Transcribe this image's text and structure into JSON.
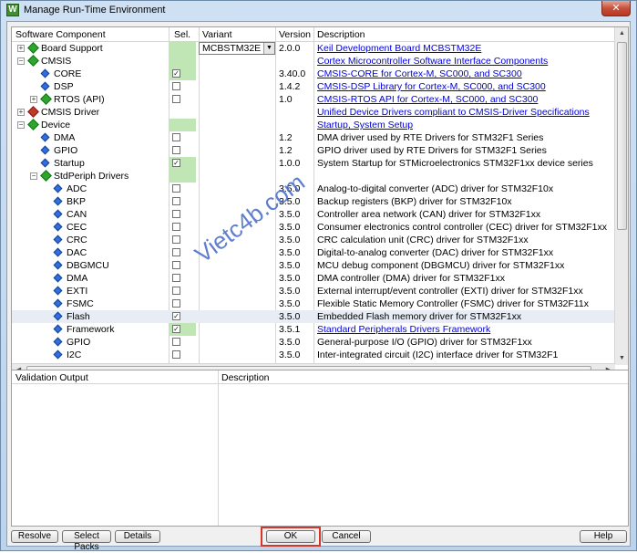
{
  "window": {
    "title": "Manage Run-Time Environment",
    "close_label": "✕"
  },
  "columns": {
    "component": "Software Component",
    "sel": "Sel.",
    "variant": "Variant",
    "version": "Version",
    "description": "Description"
  },
  "rows": [
    {
      "name": "Board Support",
      "variant": "MCBSTM32E",
      "version": "2.0.0",
      "desc": "Keil Development Board MCBSTM32E",
      "link": true
    },
    {
      "name": "CMSIS",
      "version": "",
      "desc": "Cortex Microcontroller Software Interface Components",
      "link": true
    },
    {
      "name": "CORE",
      "version": "3.40.0",
      "desc": "CMSIS-CORE for Cortex-M, SC000, and SC300",
      "link": true,
      "checked": true
    },
    {
      "name": "DSP",
      "version": "1.4.2",
      "desc": "CMSIS-DSP Library for Cortex-M, SC000, and SC300",
      "link": true
    },
    {
      "name": "RTOS (API)",
      "version": "1.0",
      "desc": "CMSIS-RTOS API for Cortex-M, SC000, and SC300",
      "link": true
    },
    {
      "name": "CMSIS Driver",
      "version": "",
      "desc": "Unified Device Drivers compliant to CMSIS-Driver Specifications",
      "link": true
    },
    {
      "name": "Device",
      "version": "",
      "desc": "Startup, System Setup",
      "link": true
    },
    {
      "name": "DMA",
      "version": "1.2",
      "desc": "DMA driver used by RTE Drivers for STM32F1 Series"
    },
    {
      "name": "GPIO",
      "version": "1.2",
      "desc": "GPIO driver used by RTE Drivers for STM32F1 Series"
    },
    {
      "name": "Startup",
      "version": "1.0.0",
      "desc": "System Startup for STMicroelectronics STM32F1xx device series",
      "checked": true
    },
    {
      "name": "StdPeriph Drivers",
      "version": "",
      "desc": ""
    },
    {
      "name": "ADC",
      "version": "3.5.0",
      "desc": "Analog-to-digital converter (ADC) driver for STM32F10x"
    },
    {
      "name": "BKP",
      "version": "3.5.0",
      "desc": "Backup registers (BKP) driver for STM32F10x"
    },
    {
      "name": "CAN",
      "version": "3.5.0",
      "desc": "Controller area network (CAN) driver for STM32F1xx"
    },
    {
      "name": "CEC",
      "version": "3.5.0",
      "desc": "Consumer electronics control controller (CEC) driver for STM32F1xx"
    },
    {
      "name": "CRC",
      "version": "3.5.0",
      "desc": "CRC calculation unit (CRC) driver for STM32F1xx"
    },
    {
      "name": "DAC",
      "version": "3.5.0",
      "desc": "Digital-to-analog converter (DAC) driver for STM32F1xx"
    },
    {
      "name": "DBGMCU",
      "version": "3.5.0",
      "desc": "MCU debug component (DBGMCU) driver for STM32F1xx"
    },
    {
      "name": "DMA",
      "version": "3.5.0",
      "desc": "DMA controller (DMA) driver for STM32F1xx"
    },
    {
      "name": "EXTI",
      "version": "3.5.0",
      "desc": "External interrupt/event controller (EXTI) driver for STM32F1xx"
    },
    {
      "name": "FSMC",
      "version": "3.5.0",
      "desc": "Flexible Static Memory Controller (FSMC) driver for STM32F11x"
    },
    {
      "name": "Flash",
      "version": "3.5.0",
      "desc": "Embedded Flash memory driver for STM32F1xx",
      "checked": true
    },
    {
      "name": "Framework",
      "version": "3.5.1",
      "desc": "Standard Peripherals Drivers Framework",
      "link": true,
      "checked": true
    },
    {
      "name": "GPIO",
      "version": "3.5.0",
      "desc": "General-purpose I/O (GPIO) driver for STM32F1xx"
    },
    {
      "name": "I2C",
      "version": "3.5.0",
      "desc": "Inter-integrated circuit (I2C) interface driver for STM32F1"
    }
  ],
  "watermark": "Vietc4b.com",
  "validation": {
    "output_header": "Validation Output",
    "description_header": "Description"
  },
  "buttons": {
    "resolve": "Resolve",
    "select_packs": "Select Packs",
    "details": "Details",
    "ok": "OK",
    "cancel": "Cancel",
    "help": "Help"
  }
}
